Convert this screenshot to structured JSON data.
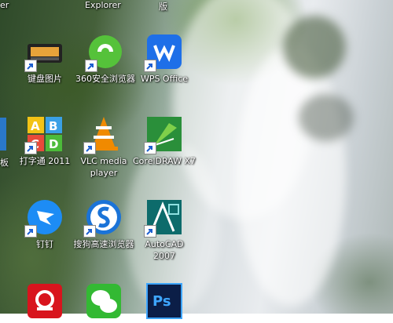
{
  "desktop": {
    "top_labels": [
      "er",
      "Explorer",
      "版"
    ],
    "icons": [
      {
        "label": "键盘图片",
        "icon": "keyboard-picture-icon"
      },
      {
        "label": "360安全浏览器",
        "icon": "360-browser-icon"
      },
      {
        "label": "WPS Office",
        "icon": "wps-office-icon"
      },
      {
        "label": "打字通 2011",
        "icon": "typing-abc-icon"
      },
      {
        "label": "VLC media player",
        "icon": "vlc-cone-icon"
      },
      {
        "label": "CorelDRAW X7",
        "icon": "coreldraw-icon"
      },
      {
        "label": "钉钉",
        "icon": "dingtalk-icon"
      },
      {
        "label": "搜狗高速浏览器",
        "icon": "sogou-browser-icon"
      },
      {
        "label": "AutoCAD 2007",
        "icon": "autocad-icon"
      },
      {
        "label": "",
        "icon": "red-app-icon"
      },
      {
        "label": "",
        "icon": "wechat-icon"
      },
      {
        "label": "",
        "icon": "photoshop-icon"
      }
    ],
    "left_partial_labels": [
      "板"
    ]
  },
  "colors": {
    "wps": "#1e6fe8",
    "vlc": "#f08a00",
    "coreldraw": "#2a8f3a",
    "dingtalk": "#1d8cf5",
    "sogou": "#1a73d8",
    "autocad": "#0d6b6b",
    "red": "#d8141d",
    "wechat": "#33b933",
    "photoshop": "#0b1e47"
  }
}
